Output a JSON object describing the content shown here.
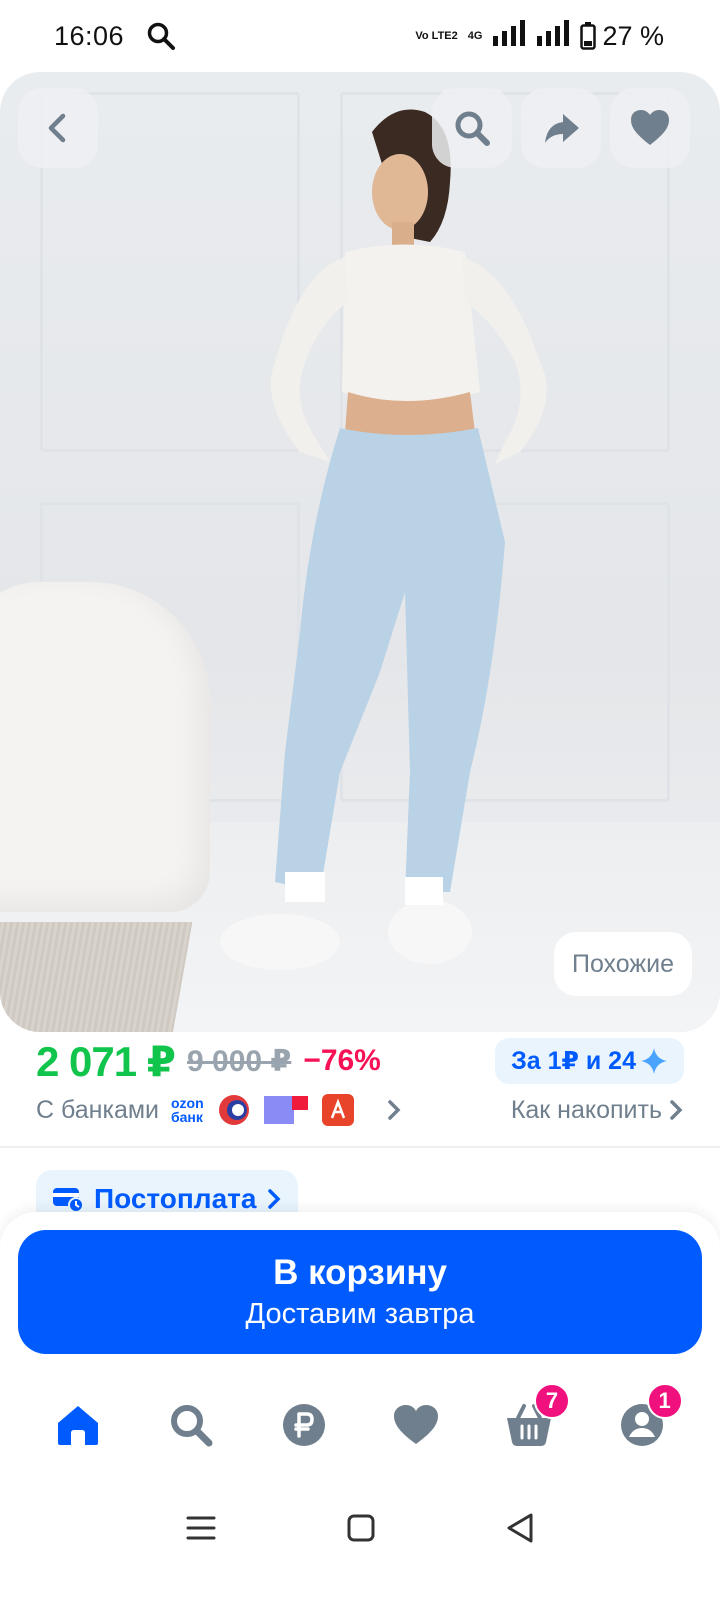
{
  "status_bar": {
    "time": "16:06",
    "network_tag": "Vo LTE2",
    "signal_tag": "4G",
    "battery": "27 %",
    "icons": [
      "search-icon",
      "signal-icon",
      "battery-icon"
    ]
  },
  "hero": {
    "similar_label": "Похожие",
    "icons": [
      "back-icon",
      "search-icon",
      "share-icon",
      "heart-icon"
    ]
  },
  "price": {
    "current": "2 071 ₽",
    "old": "9 000 ₽",
    "discount": "−76%",
    "points_badge": "За 1₽ и 24",
    "points_icon": "sparkle-icon"
  },
  "banks": {
    "label": "С банками",
    "ozon_line1": "ozon",
    "ozon_line2": "банк",
    "accumulate_label": "Как накопить"
  },
  "postpay": {
    "label": "Постоплата",
    "icon": "card-clock-icon"
  },
  "cart": {
    "title": "В корзину",
    "subtitle": "Доставим завтра"
  },
  "bottom_nav": {
    "items": [
      {
        "name": "home",
        "icon": "home-icon",
        "active": true
      },
      {
        "name": "search",
        "icon": "search-icon"
      },
      {
        "name": "finance",
        "icon": "ruble-icon"
      },
      {
        "name": "favorites",
        "icon": "heart-icon"
      },
      {
        "name": "cart",
        "icon": "basket-icon",
        "badge": "7"
      },
      {
        "name": "profile",
        "icon": "profile-icon",
        "badge": "1"
      }
    ]
  },
  "colors": {
    "accent": "#005bff",
    "price_green": "#10c44c",
    "discount_red": "#f91155",
    "badge_pink": "#f1117e",
    "nav_inactive": "#707f8d"
  }
}
